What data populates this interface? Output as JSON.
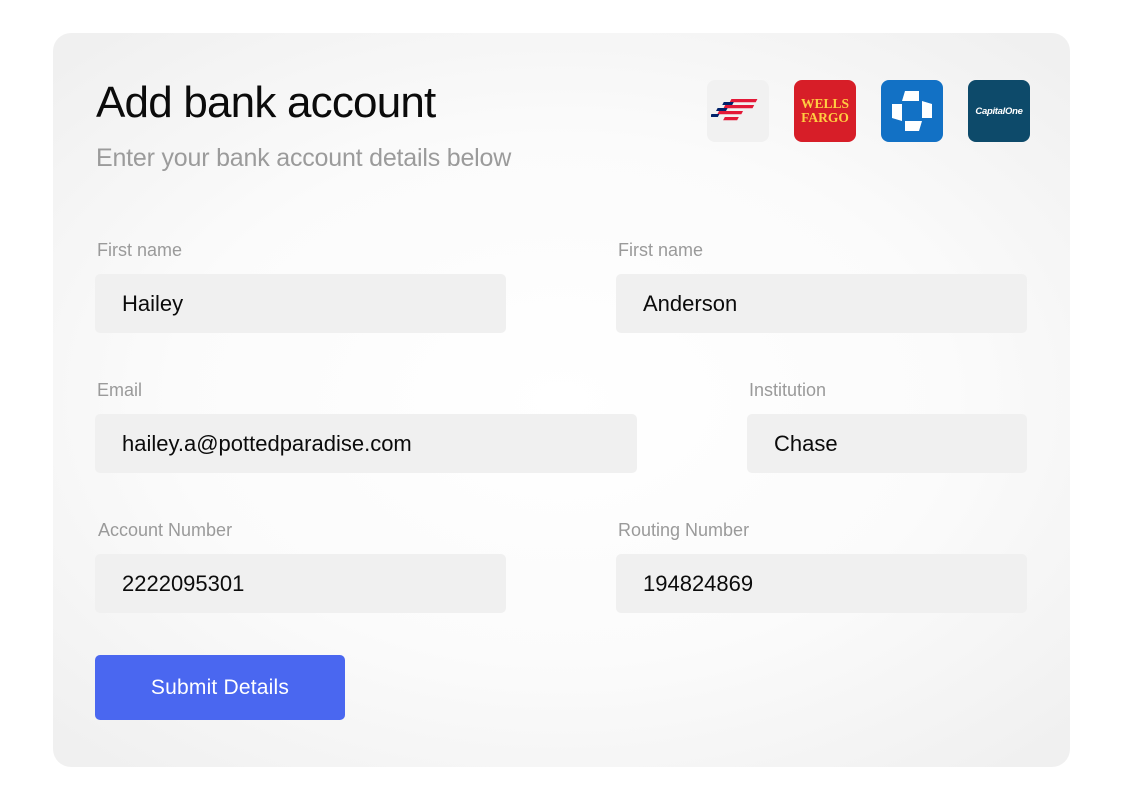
{
  "header": {
    "title": "Add bank account",
    "subtitle": "Enter your bank account details below"
  },
  "bank_logos": [
    {
      "name": "Bank of America",
      "icon": "bank-of-america-logo",
      "color": "#e31837"
    },
    {
      "name": "Wells Fargo",
      "icon": "wells-fargo-logo",
      "text_line1": "WELLS",
      "text_line2": "FARGO",
      "color": "#d71e28"
    },
    {
      "name": "Chase",
      "icon": "chase-logo",
      "color": "#1271c5"
    },
    {
      "name": "Capital One",
      "icon": "capital-one-logo",
      "text": "CapitalOne",
      "color": "#0d4a6a"
    }
  ],
  "form": {
    "first_name": {
      "label": "First name",
      "value": "Hailey"
    },
    "last_name": {
      "label": "First name",
      "value": "Anderson"
    },
    "email": {
      "label": "Email",
      "value": "hailey.a@pottedparadise.com"
    },
    "institution": {
      "label": "Institution",
      "value": "Chase"
    },
    "account_number": {
      "label": "Account Number",
      "value": "2222095301"
    },
    "routing_number": {
      "label": "Routing Number",
      "value": "194824869"
    }
  },
  "submit_label": "Submit Details",
  "colors": {
    "accent": "#4a67f0",
    "input_bg": "#f0f0f0",
    "label": "#9a9a9a",
    "text": "#0b0b0b"
  }
}
